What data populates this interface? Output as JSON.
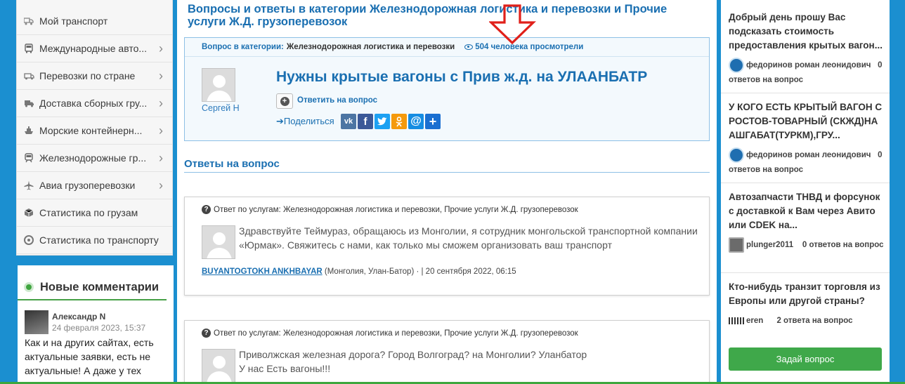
{
  "left_nav": {
    "items": [
      {
        "label": "Мой транспорт",
        "icon": "truck-icon",
        "chevron": false
      },
      {
        "label": "Международные авто...",
        "icon": "bus-icon",
        "chevron": true
      },
      {
        "label": "Перевозки по стране",
        "icon": "van-icon",
        "chevron": true
      },
      {
        "label": "Доставка сборных гру...",
        "icon": "delivery-truck-icon",
        "chevron": true
      },
      {
        "label": "Морские контейнерн...",
        "icon": "ship-icon",
        "chevron": true
      },
      {
        "label": "Железнодорожные гр...",
        "icon": "train-icon",
        "chevron": true
      },
      {
        "label": "Авиа грузоперевозки",
        "icon": "airplane-icon",
        "chevron": true
      },
      {
        "label": "Статистика по грузам",
        "icon": "cube-icon",
        "chevron": false
      },
      {
        "label": "Статистика по транспорту",
        "icon": "tire-icon",
        "chevron": false
      }
    ]
  },
  "comments": {
    "title": "Новые комментарии",
    "items": [
      {
        "author": "Александр N",
        "date": "24 февраля 2023, 15:37",
        "text": "Как и на других сайтах, есть актуальные заявки, есть не актуальные! А даже у тех"
      }
    ]
  },
  "main": {
    "page_title": "Вопросы и ответы в категории Железнодорожная логистика и перевозки и Прочие услуги Ж.Д. грузоперевозок",
    "question": {
      "category_label": "Вопрос в категории:",
      "category_value": "Железнодорожная логистика и перевозки",
      "views": "504 человека просмотрели",
      "author": "Сергей Н",
      "title": "Нужны крытые вагоны с Прив ж.д. на УЛААНБАТР",
      "answer_link": "Ответить на вопрос",
      "share_label": "Поделиться"
    },
    "answers_heading": "Ответы на вопрос",
    "answers": [
      {
        "header": "Ответ по услугам: Железнодорожная логистика и перевозки, Прочие услуги Ж.Д. грузоперевозок",
        "text_line1": "Здравствуйте Теймураз, обращаюсь из Монголии, я сотрудник монгольской транспортной компании",
        "text_line2": "«Юрмак». Свяжитесь с нами, как только мы сможем организовать ваш транспорт",
        "author": "BUYANTOGTOKH ANKHBAYAR",
        "location_date": " (Монголия, Улан-Батор) · | 20 сентября 2022, 06:15"
      },
      {
        "header": "Ответ по услугам: Железнодорожная логистика и перевозки, Прочие услуги Ж.Д. грузоперевозок",
        "text_line1": "Приволжская железная дорога? Город Волгоград? на Монголии? Уланбатор",
        "text_line2": "У нас Есть вагоны!!!"
      }
    ]
  },
  "sidebar_right": {
    "questions": [
      {
        "title": "Добрый день прошу Вас подсказать стоимость предоставления крытых вагон...",
        "author": "федоринов роман леонидович",
        "answers": "0 ответов на вопрос"
      },
      {
        "title": "У КОГО ЕСТЬ КРЫТЫЙ ВАГОН С РОСТОВ-ТОВАРНЫЙ (СКЖД)НА АШГАБАТ(ТУРКМ),ГРУ...",
        "author": "федоринов роман леонидович",
        "answers": "0 ответов на вопрос"
      },
      {
        "title": "Автозапчасти ТНВД и форсунок с доставкой к Вам через Авито или CDEK на...",
        "author": "plunger2011",
        "answers": "0 ответов на вопрос"
      },
      {
        "title": "Кто-нибудь транзит торговля из Европы или другой страны?",
        "author": "eren",
        "answers": "2 ответа на вопрос"
      }
    ],
    "ask_button": "Задай вопрос"
  },
  "colors": {
    "page_bg": "#1b8fd0",
    "link_blue": "#1a6fb1",
    "accent_green": "#3fa84a",
    "arrow_red": "#e0201a"
  }
}
